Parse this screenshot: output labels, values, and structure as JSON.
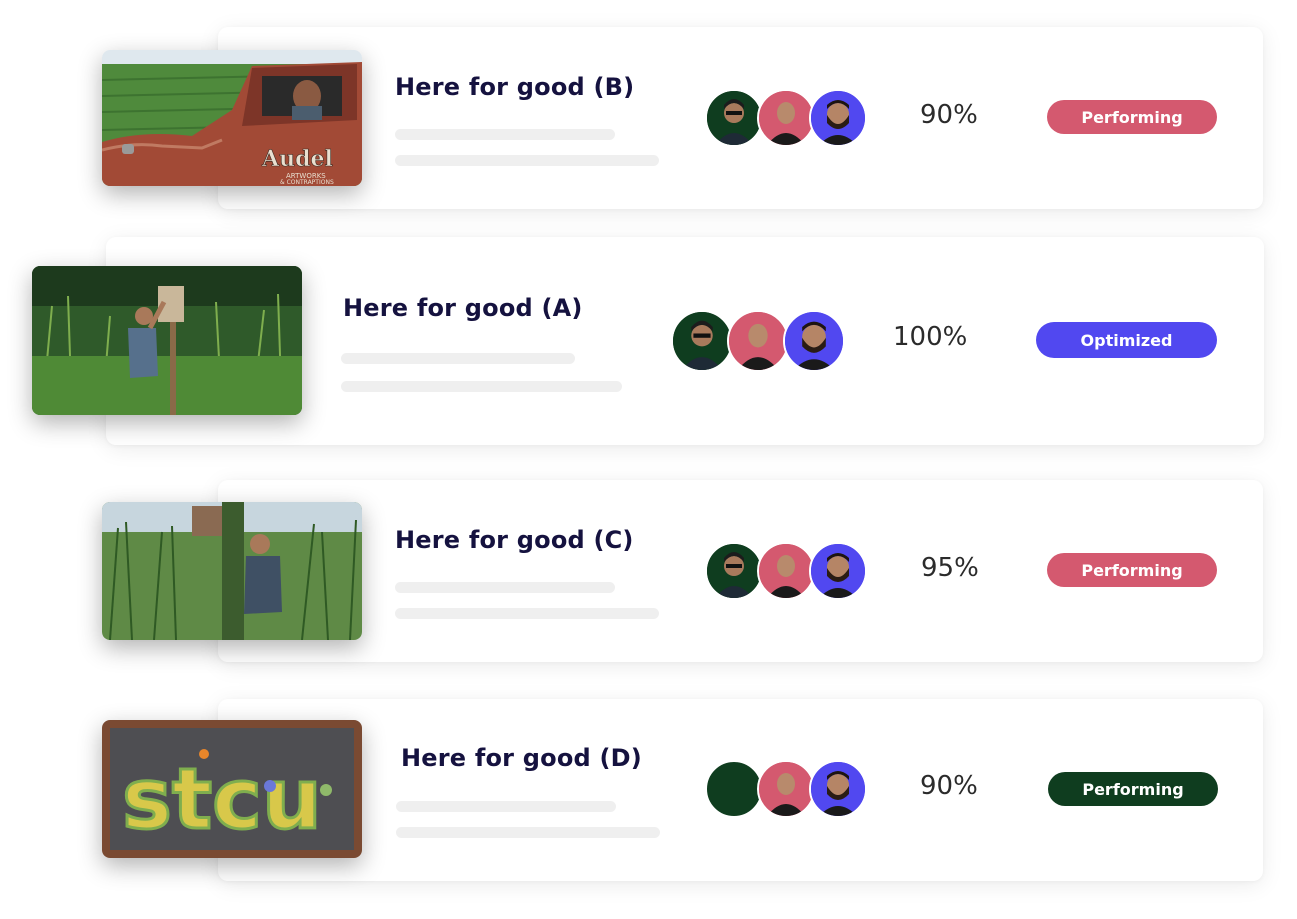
{
  "rows": [
    {
      "title": "Here for good (B)",
      "percent": "90%",
      "status": "Performing",
      "status_color": "#d4596f",
      "thumb": "Audel\nARTWORKS\n& CONTRAPTIONS"
    },
    {
      "title": "Here for good (A)",
      "percent": "100%",
      "status": "Optimized",
      "status_color": "#5148f0"
    },
    {
      "title": "Here for good (C)",
      "percent": "95%",
      "status": "Performing",
      "status_color": "#d4596f"
    },
    {
      "title": "Here for good (D)",
      "percent": "90%",
      "status": "Performing",
      "status_color": "#0f3d1f",
      "thumb": "stcu"
    }
  ],
  "colors": {
    "title": "#15123f",
    "avatar_green": "#0f3d1f",
    "avatar_pink": "#d4596f",
    "avatar_blue": "#5148f0"
  }
}
